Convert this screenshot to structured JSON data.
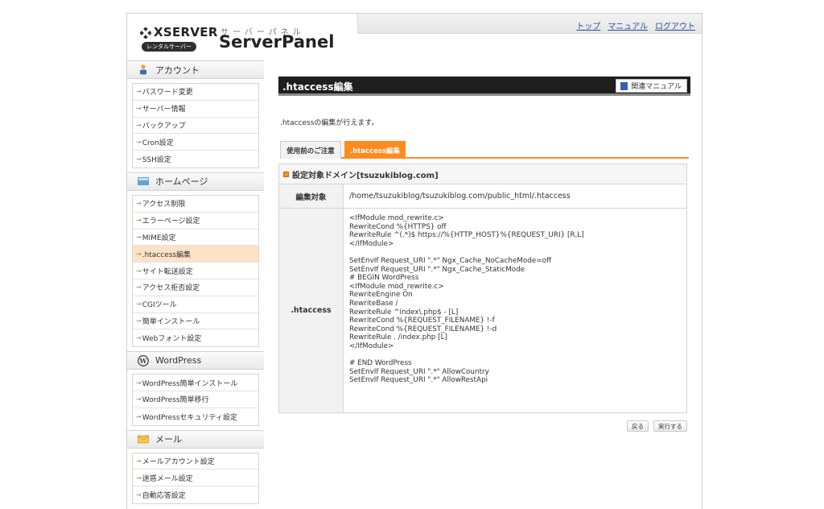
{
  "header": {
    "brand": "XSERVER",
    "brand_sub": "レンタルサーバー",
    "panel_kana": "サーバーパネル",
    "panel_name": "ServerPanel",
    "links": [
      "トップ",
      "マニュアル",
      "ログアウト"
    ]
  },
  "sidebar": {
    "sections": [
      {
        "title": "アカウント",
        "icon": "person-icon",
        "items": [
          "パスワード変更",
          "サーバー情報",
          "バックアップ",
          "Cron設定",
          "SSH設定"
        ]
      },
      {
        "title": "ホームページ",
        "icon": "homepage-icon",
        "items": [
          "アクセス制限",
          "エラーページ設定",
          "MIME設定",
          ".htaccess編集",
          "サイト転送設定",
          "アクセス拒否設定",
          "CGIツール",
          "簡単インストール",
          "Webフォント設定"
        ]
      },
      {
        "title": "WordPress",
        "icon": "wordpress-icon",
        "items": [
          "WordPress簡単インストール",
          "WordPress簡単移行",
          "WordPressセキュリティ設定"
        ]
      },
      {
        "title": "メール",
        "icon": "mail-icon",
        "items": [
          "メールアカウント設定",
          "迷惑メール設定",
          "自動応答設定"
        ]
      }
    ],
    "active_item": ".htaccess編集"
  },
  "main": {
    "title": ".htaccess編集",
    "manual_button": "関連マニュアル",
    "description": ".htaccessの編集が行えます。",
    "tabs": [
      {
        "label": "使用前のご注意",
        "active": false
      },
      {
        "label": ".htaccess編集",
        "active": true
      }
    ],
    "domain_heading": "設定対象ドメイン[tsuzukiblog.com]",
    "target_label": "編集対象",
    "target_path": "/home/tsuzukiblog/tsuzukiblog.com/public_html/.htaccess",
    "code_label": ".htaccess",
    "code": "<IfModule mod_rewrite.c>\nRewriteCond %{HTTPS} off\nRewriteRule ^(.*)$ https://%{HTTP_HOST}%{REQUEST_URI} [R,L]\n</IfModule>\n\nSetEnvIf Request_URI \".*\" Ngx_Cache_NoCacheMode=off\nSetEnvIf Request_URI \".*\" Ngx_Cache_StaticMode\n# BEGIN WordPress\n<IfModule mod_rewrite.c>\nRewriteEngine On\nRewriteBase /\nRewriteRule ^index\\.php$ - [L]\nRewriteCond %{REQUEST_FILENAME} !-f\nRewriteCond %{REQUEST_FILENAME} !-d\nRewriteRule . /index.php [L]\n</IfModule>\n\n# END WordPress\nSetEnvIf Request_URI \".*\" AllowCountry\nSetEnvIf Request_URI \".*\" AllowRestApi",
    "back_button": "戻る",
    "submit_button": "実行する"
  },
  "colors": {
    "accent_orange": "#ff8a1f",
    "active_item_bg": "#fde2c6",
    "title_bar": "#1e1e1e",
    "link_blue": "#2a4f9e"
  }
}
